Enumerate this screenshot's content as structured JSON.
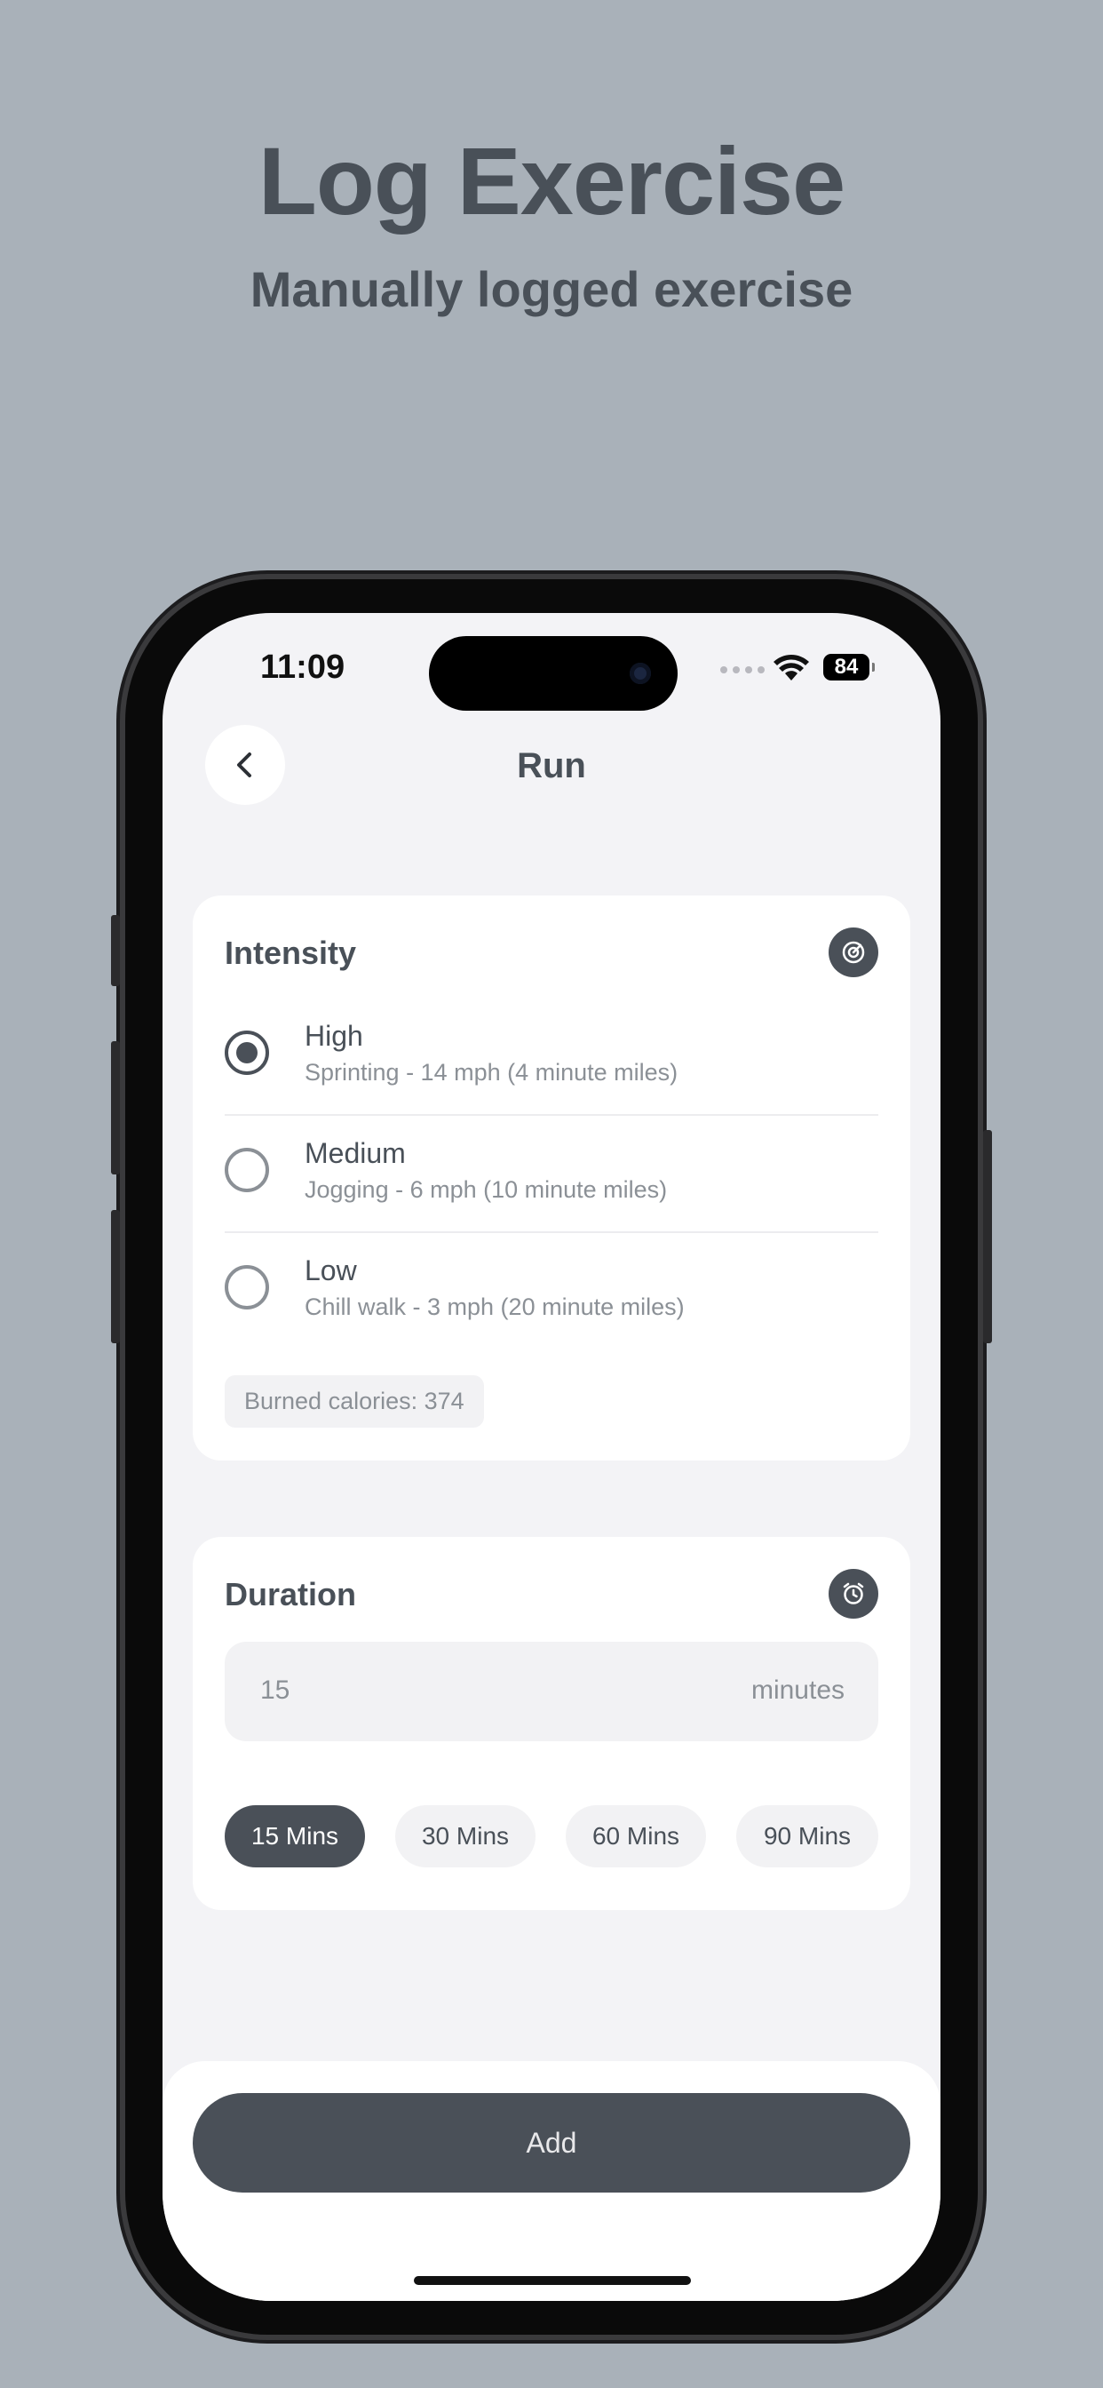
{
  "promo": {
    "title": "Log Exercise",
    "subtitle": "Manually logged exercise"
  },
  "status_bar": {
    "time": "11:09",
    "battery": "84"
  },
  "header": {
    "title": "Run",
    "back_icon": "chevron-left-icon"
  },
  "intensity": {
    "title": "Intensity",
    "icon": "target-icon",
    "options": [
      {
        "label": "High",
        "description": "Sprinting - 14 mph (4 minute miles)",
        "selected": true
      },
      {
        "label": "Medium",
        "description": "Jogging - 6 mph (10 minute miles)",
        "selected": false
      },
      {
        "label": "Low",
        "description": "Chill walk - 3 mph (20 minute miles)",
        "selected": false
      }
    ],
    "calories": "Burned calories: 374"
  },
  "duration": {
    "title": "Duration",
    "icon": "alarm-clock-icon",
    "value": "15",
    "unit": "minutes",
    "presets": [
      "15 Mins",
      "30 Mins",
      "60 Mins",
      "90 Mins"
    ],
    "selected_preset": "15 Mins"
  },
  "footer": {
    "add_label": "Add"
  },
  "colors": {
    "background": "#a9b1b9",
    "accent": "#4a5058",
    "text": "#495058",
    "muted": "#8b9096"
  }
}
